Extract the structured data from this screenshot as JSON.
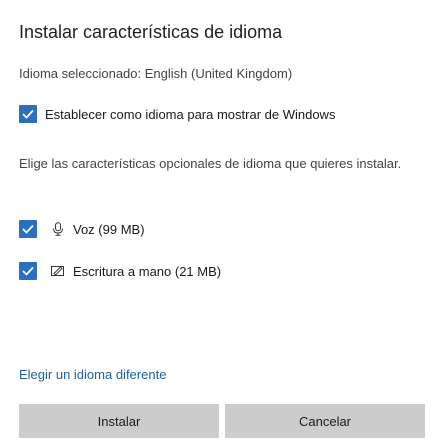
{
  "dialog": {
    "title": "Instalar características de idioma",
    "selected_language": "Idioma seleccionado: English (United Kingdom)",
    "display_language": {
      "label": "Establecer como idioma para mostrar de Windows",
      "checked": true
    },
    "description": "Elige las características opcionales de idioma que quieres instalar.",
    "features": [
      {
        "label": "Voz (99 MB)",
        "icon": "microphone-icon",
        "checked": true
      },
      {
        "label": "Escritura a mano (21 MB)",
        "icon": "handwriting-icon",
        "checked": true
      }
    ],
    "change_language_link": "Elegir un idioma diferente",
    "buttons": {
      "install": "Instalar",
      "cancel": "Cancelar"
    }
  },
  "colors": {
    "checkbox": "#2c6fc0",
    "link": "#1f5fa8",
    "button_bg": "#cccccc"
  }
}
